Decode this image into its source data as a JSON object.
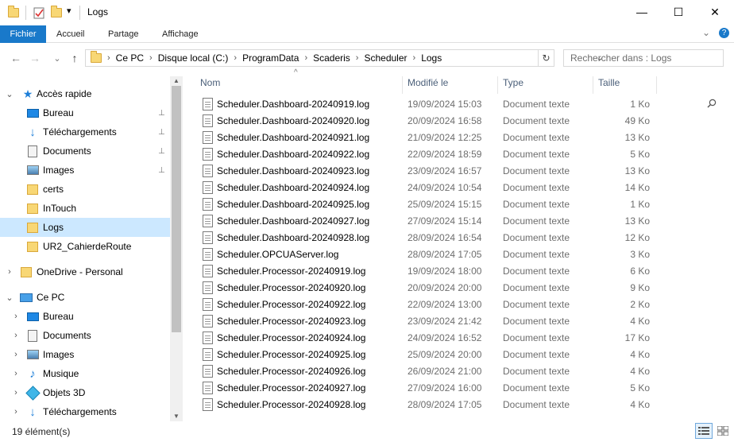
{
  "window": {
    "title": "Logs",
    "controls": {
      "minimize": "—",
      "maximize": "☐",
      "close": "✕"
    },
    "qat_dropdown": "▾"
  },
  "ribbon": {
    "tabs": [
      "Fichier",
      "Accueil",
      "Partage",
      "Affichage"
    ],
    "collapse": "⌄",
    "help": "?"
  },
  "nav": {
    "back": "←",
    "forward": "→",
    "recent": "⌄",
    "up": "↑"
  },
  "address": {
    "crumbs": [
      "Ce PC",
      "Disque local (C:)",
      "ProgramData",
      "Scaderis",
      "Scheduler",
      "Logs"
    ],
    "separator": "›",
    "dropdown": "⌄",
    "refresh": "↻"
  },
  "search": {
    "placeholder": "Rechercher dans : Logs",
    "icon": "search-icon"
  },
  "sidebar": {
    "quick_access": {
      "label": "Accès rapide",
      "icon": "star-icon"
    },
    "items": [
      {
        "label": "Bureau",
        "icon": "desktop-icon",
        "pinned": true
      },
      {
        "label": "Téléchargements",
        "icon": "download-icon",
        "pinned": true
      },
      {
        "label": "Documents",
        "icon": "documents-icon",
        "pinned": true
      },
      {
        "label": "Images",
        "icon": "images-icon",
        "pinned": true
      },
      {
        "label": "certs",
        "icon": "folder-icon",
        "pinned": false
      },
      {
        "label": "InTouch",
        "icon": "folder-icon",
        "pinned": false
      },
      {
        "label": "Logs",
        "icon": "folder-icon",
        "pinned": false,
        "selected": true
      },
      {
        "label": "UR2_CahierdeRoute",
        "icon": "folder-icon",
        "pinned": false
      }
    ],
    "onedrive": {
      "label": "OneDrive - Personal",
      "icon": "folder-icon"
    },
    "this_pc": {
      "label": "Ce PC",
      "icon": "computer-icon"
    },
    "pc_items": [
      {
        "label": "Bureau",
        "icon": "desktop-icon"
      },
      {
        "label": "Documents",
        "icon": "documents-icon"
      },
      {
        "label": "Images",
        "icon": "images-icon"
      },
      {
        "label": "Musique",
        "icon": "music-icon"
      },
      {
        "label": "Objets 3D",
        "icon": "cube-icon"
      },
      {
        "label": "Téléchargements",
        "icon": "download-icon"
      }
    ],
    "pin_glyph": "📌",
    "chevron_right": "›",
    "chevron_down": "⌄"
  },
  "columns": {
    "name": "Nom",
    "modified": "Modifié le",
    "type": "Type",
    "size": "Taille",
    "sort_indicator": "^"
  },
  "files": [
    {
      "name": "Scheduler.Dashboard-20240919.log",
      "modified": "19/09/2024 15:03",
      "type": "Document texte",
      "size": "1 Ko"
    },
    {
      "name": "Scheduler.Dashboard-20240920.log",
      "modified": "20/09/2024 16:58",
      "type": "Document texte",
      "size": "49 Ko"
    },
    {
      "name": "Scheduler.Dashboard-20240921.log",
      "modified": "21/09/2024 12:25",
      "type": "Document texte",
      "size": "13 Ko"
    },
    {
      "name": "Scheduler.Dashboard-20240922.log",
      "modified": "22/09/2024 18:59",
      "type": "Document texte",
      "size": "5 Ko"
    },
    {
      "name": "Scheduler.Dashboard-20240923.log",
      "modified": "23/09/2024 16:57",
      "type": "Document texte",
      "size": "13 Ko"
    },
    {
      "name": "Scheduler.Dashboard-20240924.log",
      "modified": "24/09/2024 10:54",
      "type": "Document texte",
      "size": "14 Ko"
    },
    {
      "name": "Scheduler.Dashboard-20240925.log",
      "modified": "25/09/2024 15:15",
      "type": "Document texte",
      "size": "1 Ko"
    },
    {
      "name": "Scheduler.Dashboard-20240927.log",
      "modified": "27/09/2024 15:14",
      "type": "Document texte",
      "size": "13 Ko"
    },
    {
      "name": "Scheduler.Dashboard-20240928.log",
      "modified": "28/09/2024 16:54",
      "type": "Document texte",
      "size": "12 Ko"
    },
    {
      "name": "Scheduler.OPCUAServer.log",
      "modified": "28/09/2024 17:05",
      "type": "Document texte",
      "size": "3 Ko"
    },
    {
      "name": "Scheduler.Processor-20240919.log",
      "modified": "19/09/2024 18:00",
      "type": "Document texte",
      "size": "6 Ko"
    },
    {
      "name": "Scheduler.Processor-20240920.log",
      "modified": "20/09/2024 20:00",
      "type": "Document texte",
      "size": "9 Ko"
    },
    {
      "name": "Scheduler.Processor-20240922.log",
      "modified": "22/09/2024 13:00",
      "type": "Document texte",
      "size": "2 Ko"
    },
    {
      "name": "Scheduler.Processor-20240923.log",
      "modified": "23/09/2024 21:42",
      "type": "Document texte",
      "size": "4 Ko"
    },
    {
      "name": "Scheduler.Processor-20240924.log",
      "modified": "24/09/2024 16:52",
      "type": "Document texte",
      "size": "17 Ko"
    },
    {
      "name": "Scheduler.Processor-20240925.log",
      "modified": "25/09/2024 20:00",
      "type": "Document texte",
      "size": "4 Ko"
    },
    {
      "name": "Scheduler.Processor-20240926.log",
      "modified": "26/09/2024 21:00",
      "type": "Document texte",
      "size": "4 Ko"
    },
    {
      "name": "Scheduler.Processor-20240927.log",
      "modified": "27/09/2024 16:00",
      "type": "Document texte",
      "size": "5 Ko"
    },
    {
      "name": "Scheduler.Processor-20240928.log",
      "modified": "28/09/2024 17:05",
      "type": "Document texte",
      "size": "4 Ko"
    }
  ],
  "status": {
    "count": "19 élément(s)"
  },
  "colors": {
    "accent": "#1979ca",
    "selection": "#cce8ff",
    "folder": "#f8d775",
    "muted_text": "#6d6d6d"
  }
}
